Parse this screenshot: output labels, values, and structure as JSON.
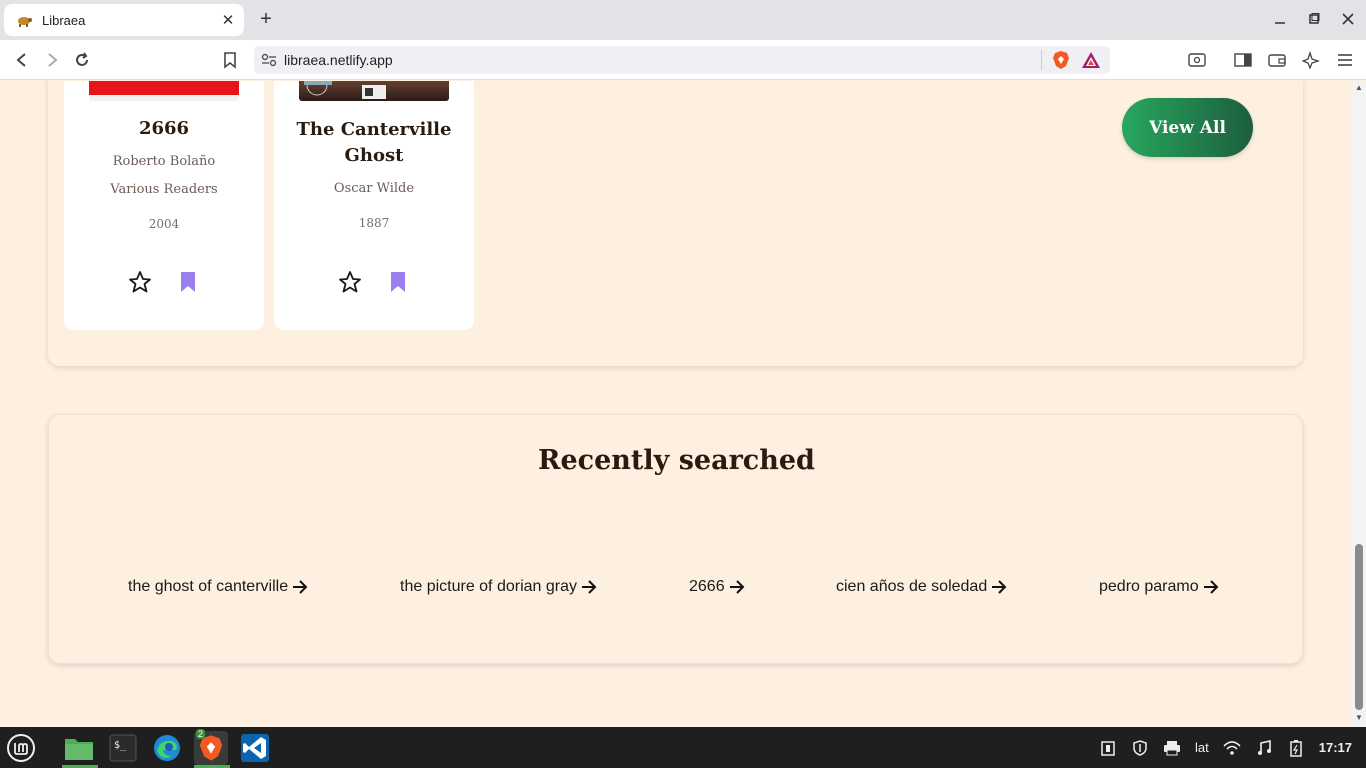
{
  "browser": {
    "tab_title": "Libraea",
    "tab_favicon": "turtle-icon",
    "url": "libraea.netlify.app",
    "new_tab_symbol": "+"
  },
  "books": [
    {
      "title": "2666",
      "author": "Roberto Bolaño",
      "narrator": "Various Readers",
      "year": "2004"
    },
    {
      "title": "The Canterville Ghost",
      "author": "Oscar Wilde",
      "year": "1887"
    }
  ],
  "view_all_label": "View All",
  "recently_searched": {
    "title": "Recently searched",
    "items": [
      "the ghost of canterville",
      "the picture of dorian gray",
      "2666",
      "cien años de soledad",
      "pedro paramo"
    ]
  },
  "taskbar": {
    "brave_badge": "2",
    "keyboard_layout": "lat",
    "clock": "17:17"
  },
  "colors": {
    "page_bg": "#fdf0e1",
    "accent_green": "#27a85e",
    "bookmark_purple": "#9b7ff0"
  }
}
